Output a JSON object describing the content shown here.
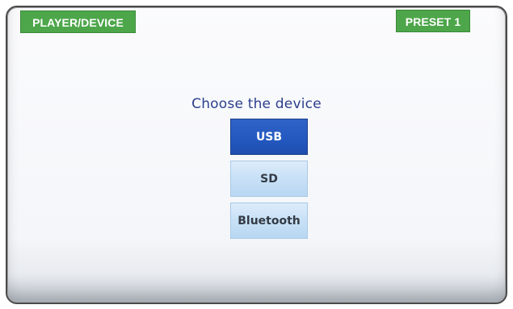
{
  "header": {
    "mode_label": "PLAYER/DEVICE",
    "preset_label": "PRESET 1"
  },
  "main": {
    "prompt": "Choose the device",
    "devices": [
      {
        "label": "USB",
        "selected": true
      },
      {
        "label": "SD",
        "selected": false
      },
      {
        "label": "Bluetooth",
        "selected": false
      }
    ]
  },
  "colors": {
    "tag_green": "#4da64a",
    "prompt_blue": "#2b3f8e",
    "selected_blue": "#2358bf",
    "unselected_light_blue": "#c7e0f6"
  }
}
